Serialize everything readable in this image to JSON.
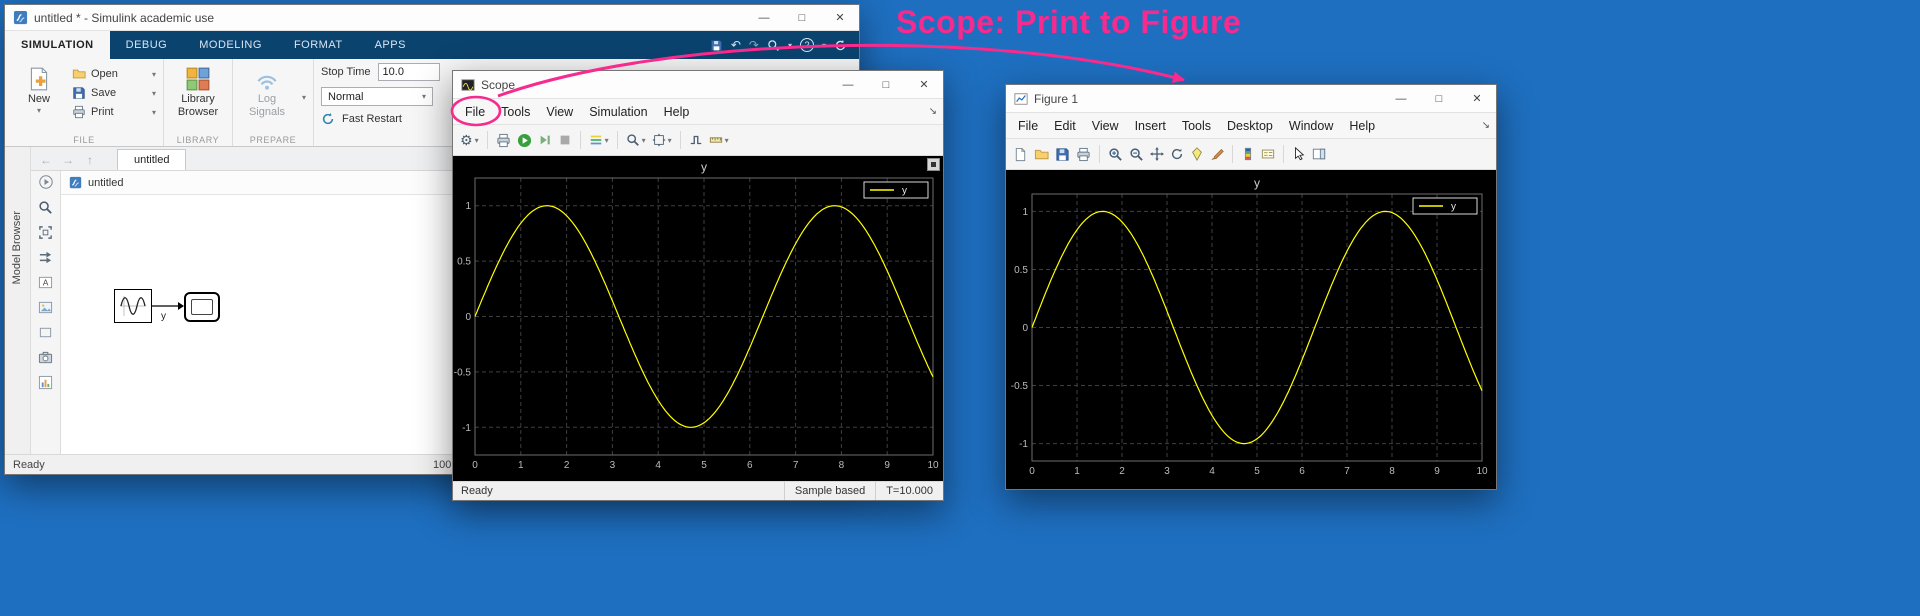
{
  "desktop": {
    "background": "#1e6fc0"
  },
  "annotation": {
    "label": "Scope: Print to Figure",
    "color": "#f72a8d"
  },
  "icons": {
    "gear": "⚙",
    "undo": "↶",
    "redo": "↷",
    "dropdown": "▾",
    "help": "?",
    "back": "←",
    "forward": "→",
    "up": "↑",
    "minimize": "—",
    "maximize": "□",
    "close": "✕",
    "corner_arrow": "↘"
  },
  "simulink": {
    "title": "untitled * - Simulink academic use",
    "tabs": [
      "SIMULATION",
      "DEBUG",
      "MODELING",
      "FORMAT",
      "APPS"
    ],
    "ribbon": {
      "new_label": "New",
      "open_label": "Open",
      "save_label": "Save",
      "print_label": "Print",
      "library_label_1": "Library",
      "library_label_2": "Browser",
      "log_label_1": "Log",
      "log_label_2": "Signals",
      "stop_time_label": "Stop Time",
      "stop_time_value": "10.0",
      "mode_value": "Normal",
      "fast_restart_label": "Fast Restart",
      "section_file": "FILE",
      "section_library": "LIBRARY",
      "section_prepare": "PREPARE"
    },
    "editor_tab": "untitled",
    "address_model": "untitled",
    "model_browser": "Model Browser",
    "canvas": {
      "signal_label": "y"
    },
    "status_left": "Ready",
    "status_zoom": "100"
  },
  "scope": {
    "title": "Scope",
    "menus": [
      "File",
      "Tools",
      "View",
      "Simulation",
      "Help"
    ],
    "status_left": "Ready",
    "status_sample": "Sample based",
    "status_time": "T=10.000"
  },
  "figure": {
    "title": "Figure 1",
    "menus": [
      "File",
      "Edit",
      "View",
      "Insert",
      "Tools",
      "Desktop",
      "Window",
      "Help"
    ]
  },
  "chart_data": [
    {
      "id": "scope-plot",
      "type": "line",
      "title": "y",
      "xlabel": "",
      "ylabel": "",
      "x_range": [
        0,
        10
      ],
      "y_range": [
        -1.25,
        1.25
      ],
      "x_ticks": [
        0,
        1,
        2,
        3,
        4,
        5,
        6,
        7,
        8,
        9,
        10
      ],
      "y_ticks": [
        -1,
        -0.5,
        0,
        0.5,
        1
      ],
      "grid": true,
      "legend": [
        "y"
      ],
      "legend_position": "northeast",
      "background": "#000000",
      "grid_color": "#3f3f3f",
      "axis_color": "#6e6e6e",
      "tick_label_color": "#bbbbbb",
      "title_color": "#d0d0d0",
      "series": [
        {
          "name": "y",
          "color": "#ffff00",
          "signal": "sine",
          "amplitude": 1,
          "angular_frequency_rad_per_s": 1,
          "phase": 0,
          "t_start": 0,
          "t_end": 10
        }
      ]
    },
    {
      "id": "figure-plot",
      "type": "line",
      "title": "y",
      "xlabel": "",
      "ylabel": "",
      "x_range": [
        0,
        10
      ],
      "y_range": [
        -1.15,
        1.15
      ],
      "x_ticks": [
        0,
        1,
        2,
        3,
        4,
        5,
        6,
        7,
        8,
        9,
        10
      ],
      "y_ticks": [
        -1,
        -0.5,
        0,
        0.5,
        1
      ],
      "grid": true,
      "legend": [
        "y"
      ],
      "legend_position": "northeast",
      "background": "#000000",
      "grid_color": "#3f3f3f",
      "axis_color": "#6e6e6e",
      "tick_label_color": "#bbbbbb",
      "title_color": "#d0d0d0",
      "series": [
        {
          "name": "y",
          "color": "#ffff00",
          "signal": "sine",
          "amplitude": 1,
          "angular_frequency_rad_per_s": 1,
          "phase": 0,
          "t_start": 0,
          "t_end": 10
        }
      ]
    }
  ]
}
